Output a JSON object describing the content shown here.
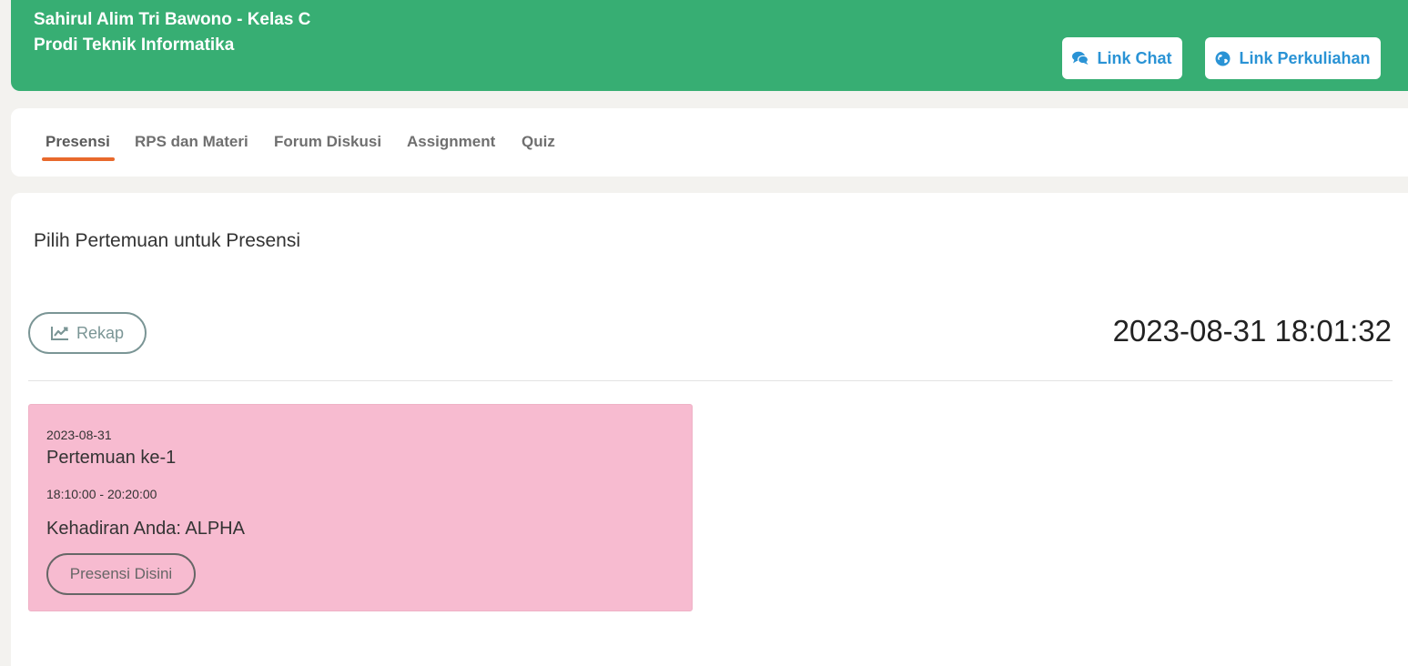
{
  "header": {
    "title_line1": "Sahirul Alim Tri Bawono - Kelas C",
    "title_line2": "Prodi Teknik Informatika",
    "chat_label": "Link Chat",
    "chat_icon": "comments-icon",
    "kuliah_label": "Link Perkuliahan",
    "kuliah_icon": "globe-icon",
    "bg_color": "#37ae73",
    "link_color": "#2a93d5"
  },
  "tabs": [
    {
      "label": "Presensi",
      "active": true
    },
    {
      "label": "RPS dan Materi",
      "active": false
    },
    {
      "label": "Forum Diskusi",
      "active": false
    },
    {
      "label": "Assignment",
      "active": false
    },
    {
      "label": "Quiz",
      "active": false
    }
  ],
  "tab_accent_color": "#e8692c",
  "main": {
    "title": "Pilih Pertemuan untuk Presensi",
    "rekap_label": "Rekap",
    "rekap_icon": "line-chart-icon",
    "clock": "2023-08-31 18:01:32"
  },
  "meetings": [
    {
      "date": "2023-08-31",
      "name": "Pertemuan ke-1",
      "time": "18:10:00 - 20:20:00",
      "status": "Kehadiran Anda: ALPHA",
      "button_label": "Presensi Disini",
      "card_color": "#f7bbd0"
    }
  ]
}
